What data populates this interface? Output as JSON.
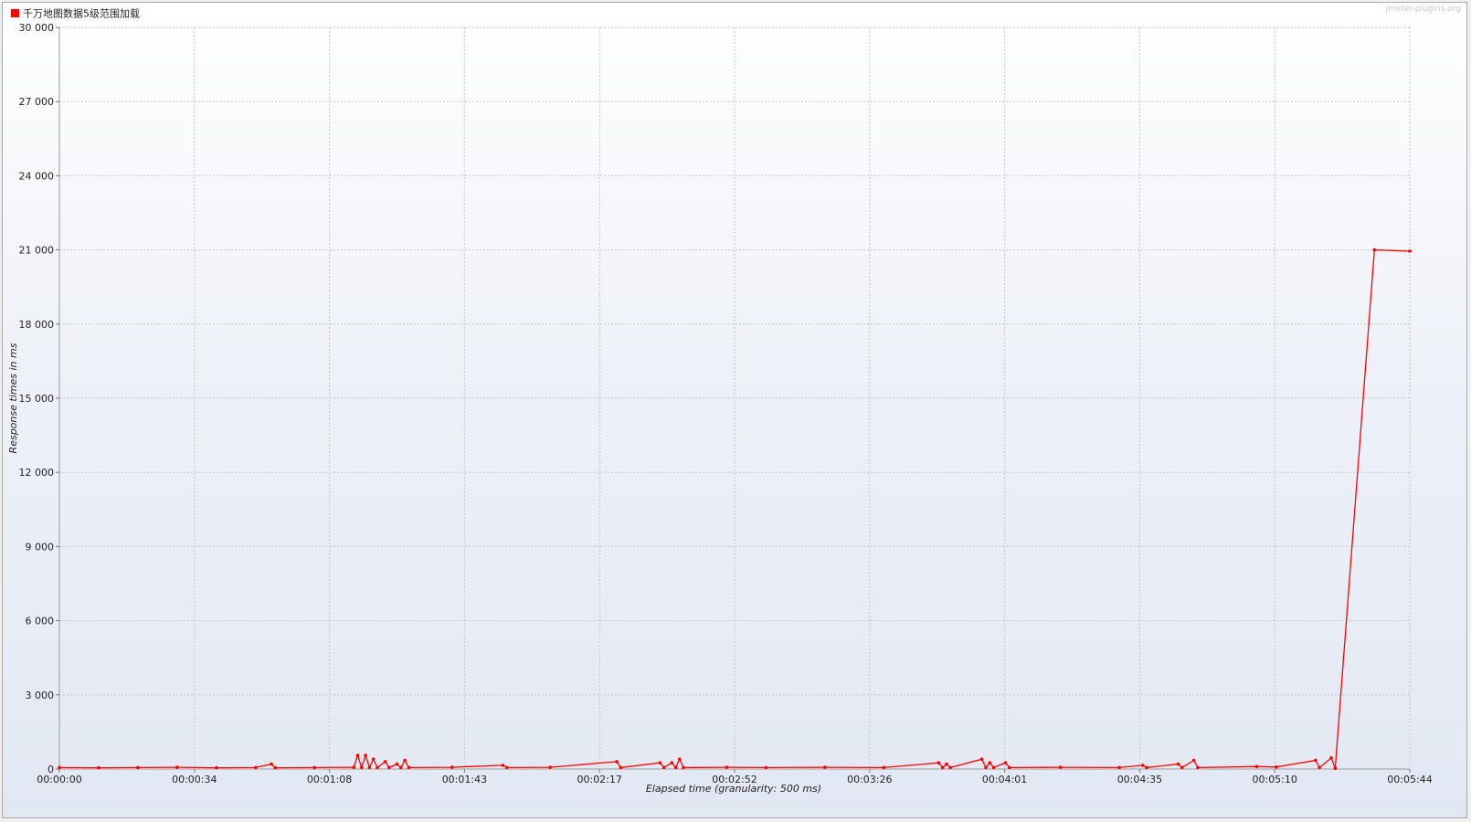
{
  "watermark": "jmeter-plugins.org",
  "chart_data": {
    "type": "line",
    "title": "",
    "xlabel": "Elapsed time (granularity: 500 ms)",
    "ylabel": "Response times in ms",
    "ylim": [
      0,
      30000
    ],
    "yticks": [
      "0",
      "3 000",
      "6 000",
      "9 000",
      "12 000",
      "15 000",
      "18 000",
      "21 000",
      "24 000",
      "27 000",
      "30 000"
    ],
    "xticks": [
      "00:00:00",
      "00:00:34",
      "00:01:08",
      "00:01:43",
      "00:02:17",
      "00:02:52",
      "00:03:26",
      "00:04:01",
      "00:04:35",
      "00:05:10",
      "00:05:44"
    ],
    "xrange_seconds": [
      0,
      344
    ],
    "grid": true,
    "legend_position": "top-left",
    "series": [
      {
        "name": "千万地图数据5级范围加载",
        "color": "#ff0000",
        "points": [
          [
            "00:00:00",
            60
          ],
          [
            "00:00:10",
            50
          ],
          [
            "00:00:20",
            60
          ],
          [
            "00:00:30",
            70
          ],
          [
            "00:00:40",
            50
          ],
          [
            "00:00:50",
            60
          ],
          [
            "00:00:54",
            200
          ],
          [
            "00:00:55",
            50
          ],
          [
            "00:01:05",
            60
          ],
          [
            "00:01:15",
            70
          ],
          [
            "00:01:16",
            550
          ],
          [
            "00:01:17",
            60
          ],
          [
            "00:01:18",
            550
          ],
          [
            "00:01:19",
            70
          ],
          [
            "00:01:20",
            400
          ],
          [
            "00:01:21",
            60
          ],
          [
            "00:01:23",
            300
          ],
          [
            "00:01:24",
            60
          ],
          [
            "00:01:26",
            200
          ],
          [
            "00:01:27",
            60
          ],
          [
            "00:01:28",
            350
          ],
          [
            "00:01:29",
            60
          ],
          [
            "00:01:40",
            70
          ],
          [
            "00:01:53",
            150
          ],
          [
            "00:01:54",
            60
          ],
          [
            "00:02:05",
            70
          ],
          [
            "00:02:22",
            300
          ],
          [
            "00:02:23",
            60
          ],
          [
            "00:02:33",
            250
          ],
          [
            "00:02:34",
            60
          ],
          [
            "00:02:36",
            250
          ],
          [
            "00:02:37",
            60
          ],
          [
            "00:02:38",
            400
          ],
          [
            "00:02:39",
            60
          ],
          [
            "00:02:50",
            70
          ],
          [
            "00:03:00",
            60
          ],
          [
            "00:03:15",
            70
          ],
          [
            "00:03:30",
            60
          ],
          [
            "00:03:44",
            250
          ],
          [
            "00:03:45",
            60
          ],
          [
            "00:03:46",
            200
          ],
          [
            "00:03:47",
            60
          ],
          [
            "00:03:55",
            400
          ],
          [
            "00:03:56",
            60
          ],
          [
            "00:03:57",
            250
          ],
          [
            "00:03:58",
            60
          ],
          [
            "00:04:01",
            250
          ],
          [
            "00:04:02",
            60
          ],
          [
            "00:04:15",
            70
          ],
          [
            "00:04:30",
            60
          ],
          [
            "00:04:36",
            150
          ],
          [
            "00:04:37",
            60
          ],
          [
            "00:04:45",
            200
          ],
          [
            "00:04:46",
            60
          ],
          [
            "00:04:49",
            350
          ],
          [
            "00:04:50",
            60
          ],
          [
            "00:05:05",
            100
          ],
          [
            "00:05:10",
            80
          ],
          [
            "00:05:20",
            350
          ],
          [
            "00:05:21",
            60
          ],
          [
            "00:05:24",
            450
          ],
          [
            "00:05:25",
            30
          ],
          [
            "00:05:35",
            21000
          ],
          [
            "00:05:44",
            20950
          ]
        ]
      }
    ]
  }
}
